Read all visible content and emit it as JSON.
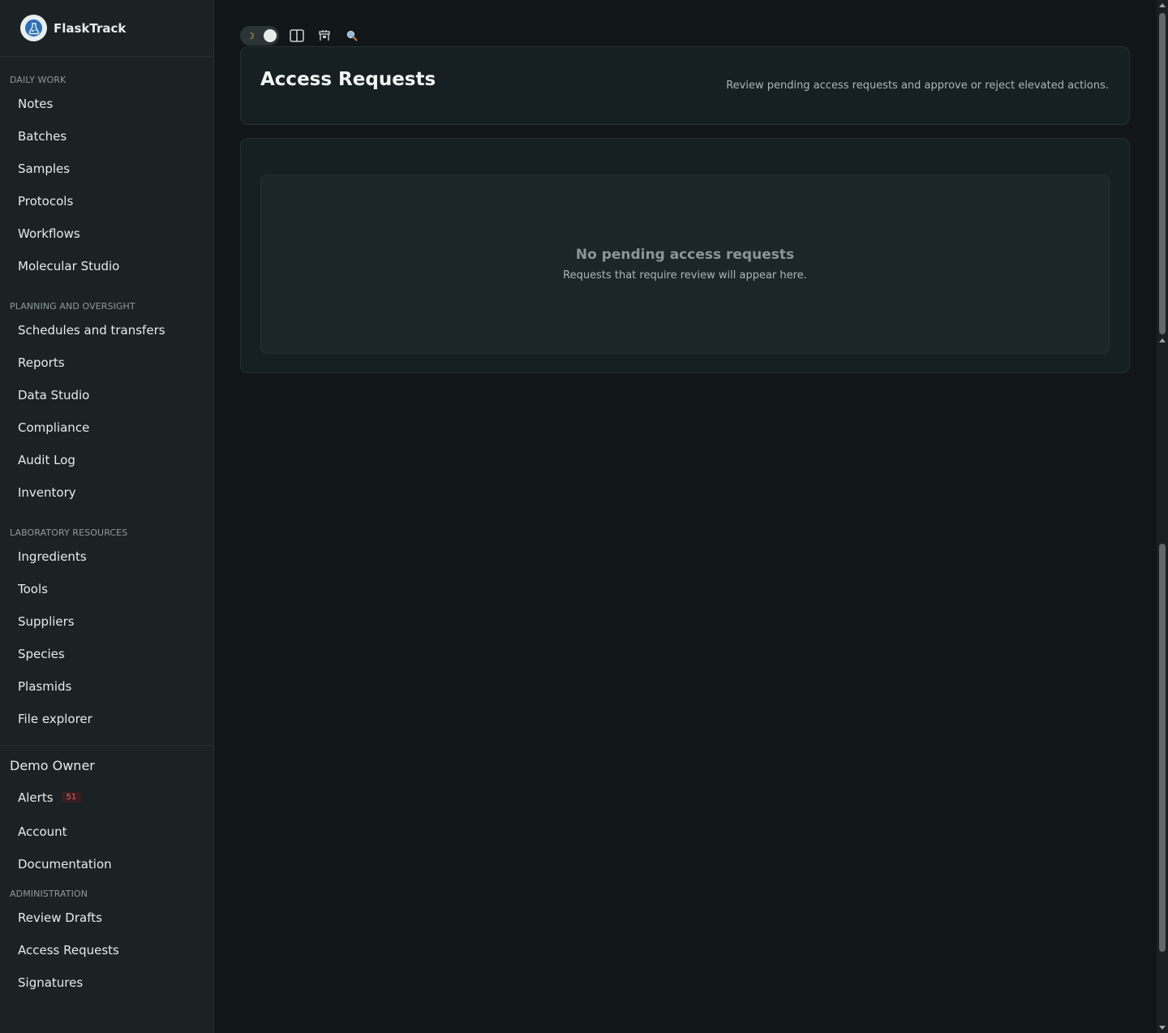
{
  "brand": {
    "name": "FlaskTrack"
  },
  "sidebar": {
    "daily_work": {
      "label": "DAILY WORK",
      "items": [
        "Notes",
        "Batches",
        "Samples",
        "Protocols",
        "Workflows",
        "Molecular Studio"
      ]
    },
    "planning": {
      "label": "PLANNING AND OVERSIGHT",
      "items": [
        "Schedules and transfers",
        "Reports",
        "Data Studio",
        "Compliance",
        "Audit Log",
        "Inventory"
      ]
    },
    "lab_resources": {
      "label": "LABORATORY RESOURCES",
      "items": [
        "Ingredients",
        "Tools",
        "Suppliers",
        "Species",
        "Plasmids",
        "File explorer"
      ]
    },
    "user": {
      "name": "Demo Owner",
      "alerts_label": "Alerts",
      "alerts_count": "51",
      "items": [
        "Account",
        "Documentation"
      ]
    },
    "administration": {
      "label": "ADMINISTRATION",
      "items": [
        "Review Drafts",
        "Access Requests",
        "Signatures"
      ]
    }
  },
  "toolbar": {
    "icons": [
      "theme-toggle",
      "split-view-icon",
      "desk-icon",
      "search-icon"
    ],
    "moon": "☽"
  },
  "header": {
    "title": "Access Requests",
    "subtitle": "Review pending access requests and approve or reject elevated actions."
  },
  "empty_state": {
    "title": "No pending access requests",
    "text": "Requests that require review will appear here."
  },
  "colors": {
    "background": "#111718",
    "sidebar": "#1b2224",
    "badge_text": "#e0646b"
  }
}
